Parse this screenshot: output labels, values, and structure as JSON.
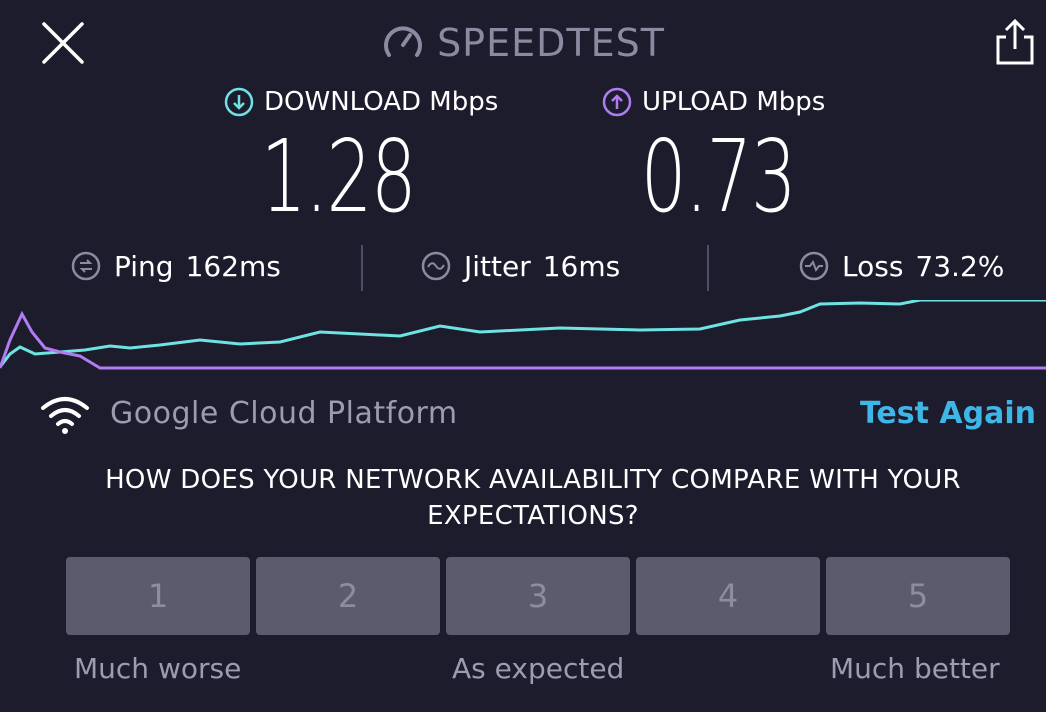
{
  "header": {
    "brand": "SPEEDTEST",
    "close_icon": "close-icon",
    "share_icon": "share-icon"
  },
  "download": {
    "label": "DOWNLOAD Mbps",
    "value": "1.28",
    "icon": "download-arrow-icon",
    "color": "#6fe3e3"
  },
  "upload": {
    "label": "UPLOAD Mbps",
    "value": "0.73",
    "icon": "upload-arrow-icon",
    "color": "#b07cf0"
  },
  "stats": {
    "ping": {
      "label": "Ping",
      "value": "162ms"
    },
    "jitter": {
      "label": "Jitter",
      "value": "16ms"
    },
    "loss": {
      "label": "Loss",
      "value": "73.2%"
    }
  },
  "server": {
    "name": "Google Cloud Platform",
    "icon": "wifi-icon"
  },
  "test_again_label": "Test Again",
  "question": {
    "line1": "HOW DOES YOUR NETWORK AVAILABILITY COMPARE WITH YOUR",
    "line2": "EXPECTATIONS?"
  },
  "ratings": [
    "1",
    "2",
    "3",
    "4",
    "5"
  ],
  "scale_labels": {
    "low": "Much worse",
    "mid": "As expected",
    "high": "Much better"
  },
  "colors": {
    "background": "#1d1c2d",
    "accent": "#3fb6e8",
    "download": "#6fe3e3",
    "upload": "#b07cf0"
  }
}
